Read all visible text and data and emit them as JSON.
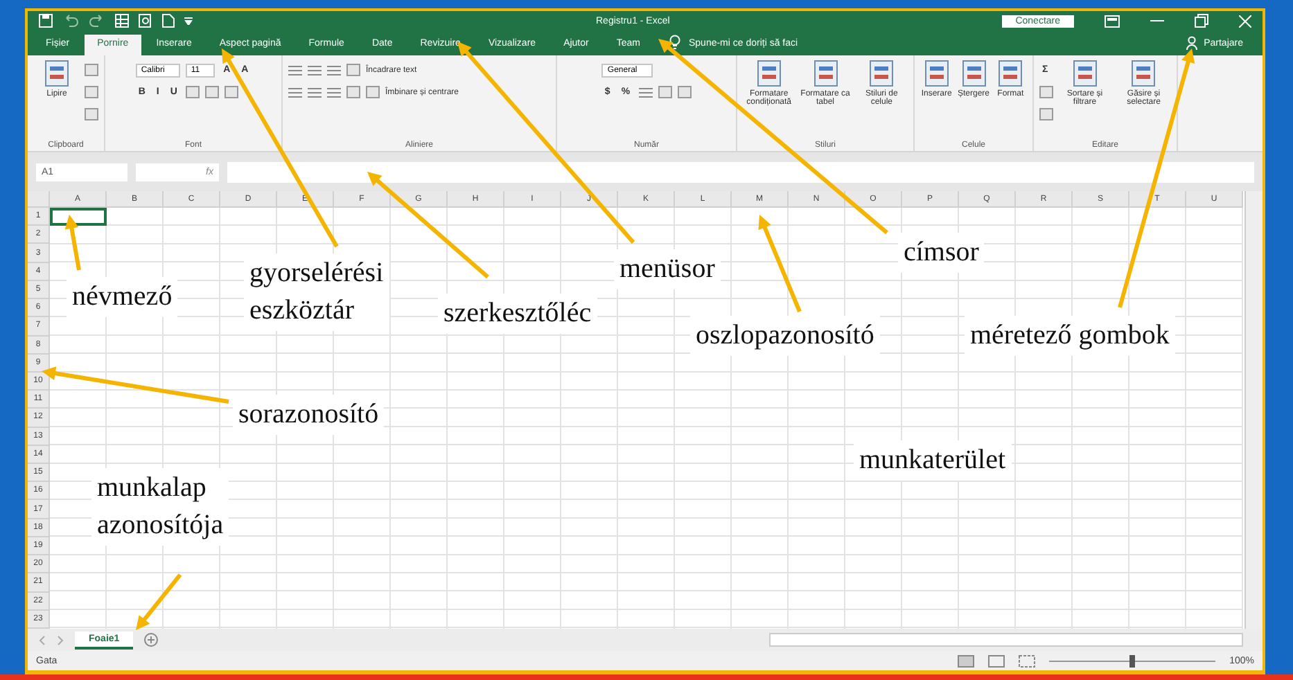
{
  "window": {
    "title": "Registru1 - Excel",
    "sign_in": "Conectare"
  },
  "tabs": [
    {
      "label": "Fișier",
      "selected": false
    },
    {
      "label": "Pornire",
      "selected": true
    },
    {
      "label": "Inserare",
      "selected": false
    },
    {
      "label": "Aspect pagină",
      "selected": false
    },
    {
      "label": "Formule",
      "selected": false
    },
    {
      "label": "Date",
      "selected": false
    },
    {
      "label": "Revizuire",
      "selected": false
    },
    {
      "label": "Vizualizare",
      "selected": false
    },
    {
      "label": "Ajutor",
      "selected": false
    },
    {
      "label": "Team",
      "selected": false
    }
  ],
  "tell_me": "Spune-mi ce doriți să faci",
  "share": "Partajare",
  "ribbon": [
    {
      "label": "Clipboard",
      "items": [
        {
          "kind": "large",
          "label": "Lipire"
        },
        {
          "kind": "stack",
          "tools": [
            [
              {
                "kind": "square"
              }
            ],
            [
              {
                "kind": "square"
              }
            ],
            [
              {
                "kind": "square"
              }
            ]
          ]
        }
      ]
    },
    {
      "label": "Font",
      "items": [
        {
          "kind": "stack",
          "tools": [
            [
              {
                "kind": "combo",
                "text": "Calibri"
              },
              {
                "kind": "combo",
                "text": "11"
              },
              {
                "kind": "glyph",
                "text": "A"
              },
              {
                "kind": "glyph",
                "text": "A"
              }
            ],
            [
              {
                "kind": "glyph",
                "text": "B"
              },
              {
                "kind": "glyph",
                "text": "I"
              },
              {
                "kind": "glyph",
                "text": "U"
              },
              {
                "kind": "square"
              },
              {
                "kind": "square"
              },
              {
                "kind": "square"
              }
            ]
          ]
        }
      ]
    },
    {
      "label": "Aliniere",
      "items": [
        {
          "kind": "stack",
          "tools": [
            [
              {
                "kind": "lines"
              },
              {
                "kind": "lines"
              },
              {
                "kind": "lines"
              },
              {
                "kind": "square"
              },
              {
                "kind": "button",
                "text": "Încadrare text"
              }
            ],
            [
              {
                "kind": "lines"
              },
              {
                "kind": "lines"
              },
              {
                "kind": "lines"
              },
              {
                "kind": "square"
              },
              {
                "kind": "square"
              },
              {
                "kind": "button",
                "text": "Îmbinare și centrare"
              }
            ]
          ]
        }
      ]
    },
    {
      "label": "Număr",
      "items": [
        {
          "kind": "stack",
          "tools": [
            [
              {
                "kind": "combo",
                "text": "General"
              }
            ],
            [
              {
                "kind": "glyph",
                "text": "$"
              },
              {
                "kind": "glyph",
                "text": "%"
              },
              {
                "kind": "lines"
              },
              {
                "kind": "square"
              },
              {
                "kind": "square"
              }
            ]
          ]
        }
      ]
    },
    {
      "label": "Stiluri",
      "items": [
        {
          "kind": "large",
          "label": "Formatare condiționată"
        },
        {
          "kind": "large",
          "label": "Formatare ca tabel"
        },
        {
          "kind": "large",
          "label": "Stiluri de celule"
        }
      ]
    },
    {
      "label": "Celule",
      "items": [
        {
          "kind": "large",
          "label": "Inserare"
        },
        {
          "kind": "large",
          "label": "Ștergere"
        },
        {
          "kind": "large",
          "label": "Format"
        }
      ]
    },
    {
      "label": "Editare",
      "items": [
        {
          "kind": "stack",
          "tools": [
            [
              {
                "kind": "glyph",
                "text": "Σ"
              }
            ],
            [
              {
                "kind": "square"
              }
            ],
            [
              {
                "kind": "square"
              }
            ]
          ]
        },
        {
          "kind": "large",
          "label": "Sortare și filtrare"
        },
        {
          "kind": "large",
          "label": "Găsire și selectare"
        }
      ]
    }
  ],
  "name_box": "A1",
  "formula_label": "fx",
  "columns": [
    "A",
    "B",
    "C",
    "D",
    "E",
    "F",
    "G",
    "H",
    "I",
    "J",
    "K",
    "L",
    "M",
    "N",
    "O",
    "P",
    "Q",
    "R",
    "S",
    "T",
    "U"
  ],
  "rows": [
    "1",
    "2",
    "3",
    "4",
    "5",
    "6",
    "7",
    "8",
    "9",
    "10",
    "11",
    "12",
    "13",
    "14",
    "15",
    "16",
    "17",
    "18",
    "19",
    "20",
    "21",
    "22",
    "23"
  ],
  "sheets": [
    {
      "label": "Foaie1",
      "selected": true
    }
  ],
  "status": "Gata",
  "zoom_slider": {
    "level": 0.5
  },
  "zoom": "100%",
  "annotations": [
    {
      "lines": [
        "névmező"
      ],
      "arrow": true
    },
    {
      "lines": [
        "gyorselérési",
        "eszköztár"
      ],
      "arrow": true
    },
    {
      "lines": [
        "szerkesztőléc"
      ],
      "arrow": true
    },
    {
      "lines": [
        "menüsor"
      ],
      "arrow": true
    },
    {
      "lines": [
        "címsor"
      ],
      "arrow": true
    },
    {
      "lines": [
        "oszlopazonosító"
      ],
      "arrow": true
    },
    {
      "lines": [
        "méretező gombok"
      ],
      "arrow": true
    },
    {
      "lines": [
        "sorazonosító"
      ],
      "arrow": true
    },
    {
      "lines": [
        "munkaterület"
      ],
      "arrow": false
    },
    {
      "lines": [
        "munkalap",
        "azonosítója"
      ],
      "arrow": true
    }
  ]
}
